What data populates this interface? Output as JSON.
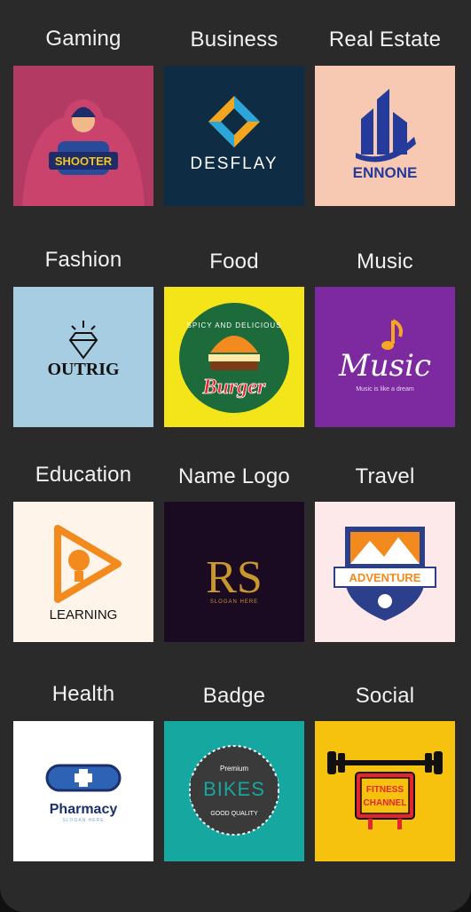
{
  "categories": [
    {
      "label": "Gaming",
      "logo_text": "SHOOTER",
      "bg": "#b33a63"
    },
    {
      "label": "Business",
      "logo_text": "DESFLAY",
      "bg": "#0f2c45"
    },
    {
      "label": "Real Estate",
      "logo_text": "ENNONE",
      "bg": "#f8c9b2"
    },
    {
      "label": "Fashion",
      "logo_text": "OUTRIG",
      "bg": "#a6cde2"
    },
    {
      "label": "Food",
      "logo_text": "Burger",
      "logo_subtext": "SPICY AND DELICIOUS",
      "bg": "#f4e41a"
    },
    {
      "label": "Music",
      "logo_text": "Music",
      "logo_subtext": "Music is like a dream",
      "bg": "#7d2aa1"
    },
    {
      "label": "Education",
      "logo_text": "LEARNING",
      "bg": "#fff4ea"
    },
    {
      "label": "Name Logo",
      "logo_text": "RS",
      "logo_subtext": "SLOGAN HERE",
      "bg": "#1a0a22"
    },
    {
      "label": "Travel",
      "logo_text": "ADVENTURE",
      "bg": "#fde9e9"
    },
    {
      "label": "Health",
      "logo_text": "Pharmacy",
      "logo_subtext": "SLOGAN HERE",
      "bg": "#ffffff"
    },
    {
      "label": "Badge",
      "logo_text": "BIKES",
      "logo_subtext": "Premium",
      "logo_subtext2": "GOOD QUALITY",
      "bg": "#16a7a0"
    },
    {
      "label": "Social",
      "logo_text": "FITNESS",
      "logo_subtext": "CHANNEL",
      "bg": "#f7c20e"
    }
  ]
}
